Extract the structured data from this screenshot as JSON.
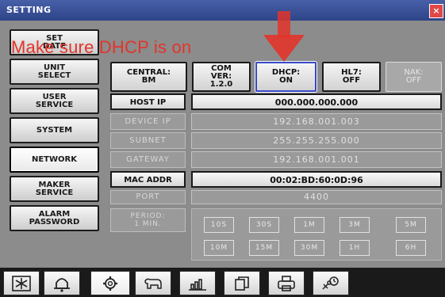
{
  "window": {
    "title": "SETTING",
    "close_glyph": "×"
  },
  "annotation": {
    "text": "Make sure DHCP is on",
    "color": "#e2342a"
  },
  "sidebar": {
    "items": [
      {
        "label": "SET\nDATE"
      },
      {
        "label": "UNIT\nSELECT"
      },
      {
        "label": "USER\nSERVICE"
      },
      {
        "label": "SYSTEM"
      },
      {
        "label": "NETWORK",
        "active": true
      },
      {
        "label": "MAKER\nSERVICE"
      },
      {
        "label": "ALARM\nPASSWORD"
      }
    ]
  },
  "toolbar": {
    "central": "CENTRAL:\nBM",
    "com_ver": "COM\nVER:\n1.2.0",
    "dhcp": "DHCP:\nON",
    "hl7": "HL7:\nOFF",
    "nak": "NAK:\nOFF"
  },
  "network": {
    "host_ip": {
      "label": "HOST IP",
      "value": "000.000.000.000"
    },
    "device_ip": {
      "label": "DEVICE IP",
      "value": "192.168.001.003"
    },
    "subnet": {
      "label": "SUBNET",
      "value": "255.255.255.000"
    },
    "gateway": {
      "label": "GATEWAY",
      "value": "192.168.001.001"
    },
    "mac_addr": {
      "label": "MAC ADDR",
      "value": "00:02:BD:60:0D:96"
    },
    "port": {
      "label": "PORT",
      "value": "4400"
    },
    "period": {
      "label": "PERIOD:\n1 MIN."
    }
  },
  "period_options": [
    "10S",
    "30S",
    "1M",
    "3M",
    "5M",
    "10M",
    "15M",
    "30M",
    "1H",
    "6H"
  ],
  "bottom_nav": [
    {
      "icon": "snowflake-icon"
    },
    {
      "icon": "bell-icon"
    },
    {
      "icon": "gear-icon",
      "active": true
    },
    {
      "icon": "animal-icon"
    },
    {
      "icon": "bar-chart-icon"
    },
    {
      "icon": "copy-icon"
    },
    {
      "icon": "printer-icon"
    },
    {
      "icon": "clock-tools-icon"
    }
  ]
}
